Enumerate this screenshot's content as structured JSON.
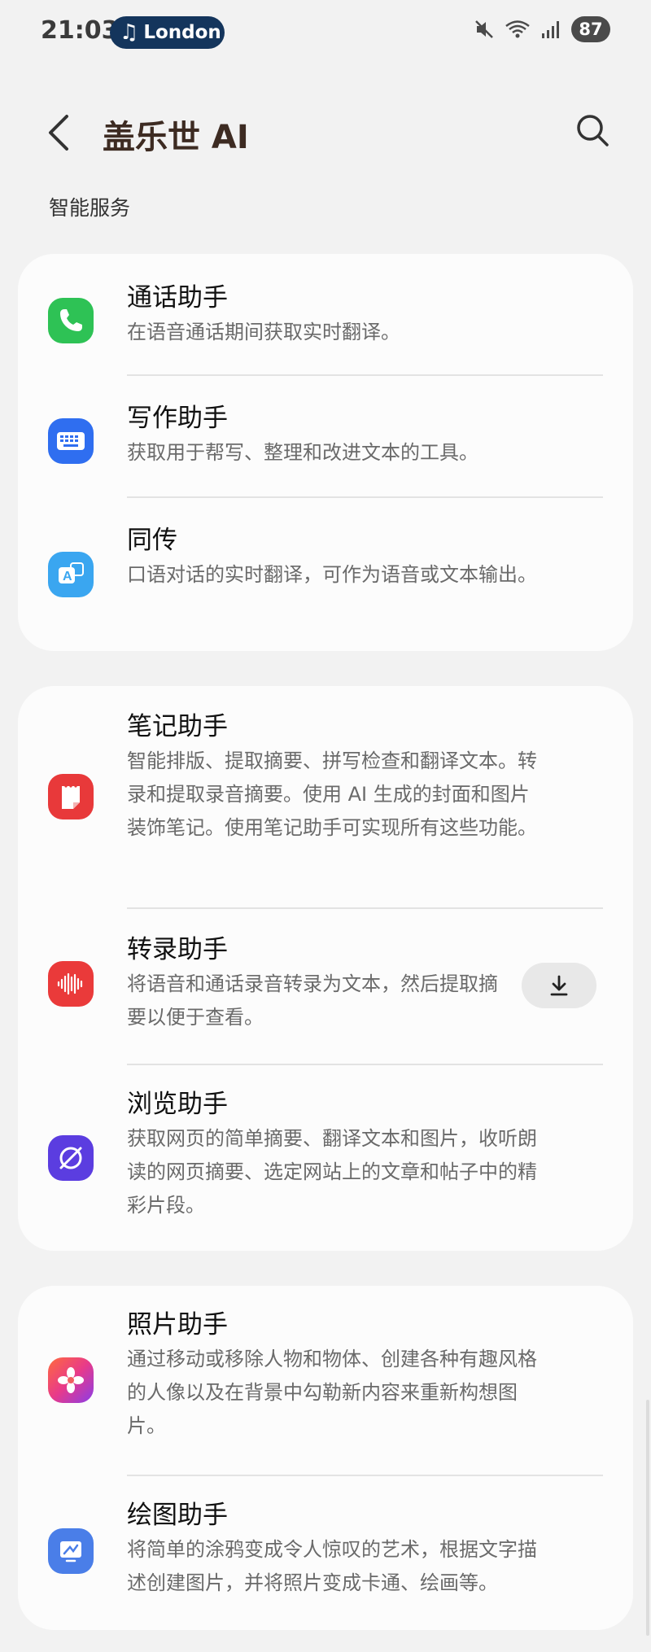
{
  "status_bar": {
    "time": "21:03",
    "music_pill": "London",
    "battery": "87"
  },
  "header": {
    "title": "盖乐世 AI"
  },
  "section_label": "智能服务",
  "groups": [
    {
      "items": [
        {
          "name": "通话助手",
          "desc": "在语音通话期间获取实时翻译。",
          "icon": "phone-icon",
          "color": "#2ec255"
        },
        {
          "name": "写作助手",
          "desc": "获取用于帮写、整理和改进文本的工具。",
          "icon": "keyboard-icon",
          "color": "#2f6ef0"
        },
        {
          "name": "同传",
          "desc": "口语对话的实时翻译，可作为语音或文本输出。",
          "icon": "translate-icon",
          "color": "#3aa6f0"
        }
      ]
    },
    {
      "items": [
        {
          "name": "笔记助手",
          "desc": "智能排版、提取摘要、拼写检查和翻译文本。转录和提取录音摘要。使用 AI 生成的封面和图片装饰笔记。使用笔记助手可实现所有这些功能。",
          "icon": "notes-icon",
          "color": "#e8393a"
        },
        {
          "name": "转录助手",
          "desc": "将语音和通话录音转录为文本，然后提取摘要以便于查看。",
          "icon": "waveform-icon",
          "color": "#ea3a3a",
          "download": true
        },
        {
          "name": "浏览助手",
          "desc": "获取网页的简单摘要、翻译文本和图片，收听朗读的网页摘要、选定网站上的文章和帖子中的精彩片段。",
          "icon": "browser-icon",
          "color": "#5b3de0"
        }
      ]
    },
    {
      "items": [
        {
          "name": "照片助手",
          "desc": "通过移动或移除人物和物体、创建各种有趣风格的人像以及在背景中勾勒新内容来重新构想图片。",
          "icon": "flower-icon",
          "color": "#f0407a"
        },
        {
          "name": "绘图助手",
          "desc": "将简单的涂鸦变成令人惊叹的艺术，根据文字描述创建图片，并将照片变成卡通、绘画等。",
          "icon": "drawing-icon",
          "color": "#4a7ee8"
        }
      ]
    }
  ]
}
